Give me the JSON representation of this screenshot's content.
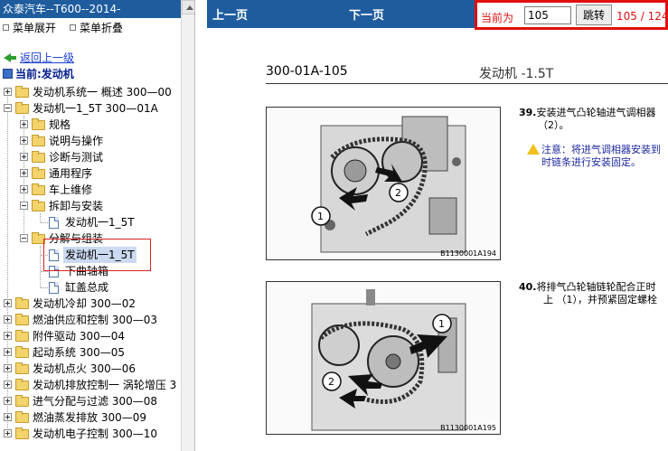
{
  "left": {
    "title": "众泰汽车--T600--2014-",
    "menu_expand": "菜单展开",
    "menu_collapse": "菜单折叠",
    "back": "返回上一级",
    "current": "当前:发动机",
    "tree": [
      "发动机系统一 概述 300—00",
      "发动机一1_5T 300—01A",
      "规格",
      "说明与操作",
      "诊断与测试",
      "通用程序",
      "车上维修",
      "拆卸与安装",
      "发动机一1_5T",
      "分解与组装",
      "发动机一1_5T",
      "下曲轴箱",
      "缸盖总成",
      "发动机冷却 300—02",
      "燃油供应和控制 300—03",
      "附件驱动 300—04",
      "起动系统 300—05",
      "发动机点火 300—06",
      "发动机排放控制一 涡轮增压 3",
      "进气分配与过滤 300—08",
      "燃油蒸发排放 300—09",
      "发动机电子控制 300—10"
    ]
  },
  "right": {
    "prev": "上一页",
    "next": "下一页",
    "current_label": "当前为",
    "page_value": "105",
    "jump": "跳转",
    "page_count": "105 / 124",
    "doc_code": "300-01A-105",
    "doc_title": "发动机 -1.5T",
    "step39_num": "39.",
    "step39_line1": "安装进气凸轮轴进气调相器",
    "step39_line2": "（2）。",
    "warn_line1": "注意：将进气调相器安装到",
    "warn_line2": "时链条进行安装固定。",
    "fig1_caption": "B1130001A194",
    "step40_num": "40.",
    "step40_line1": "将排气凸轮轴链轮配合正时",
    "step40_line2": "上 （1），并预紧固定螺栓",
    "fig2_caption": "B1130001A195",
    "callout_1": "1",
    "callout_2": "2"
  }
}
